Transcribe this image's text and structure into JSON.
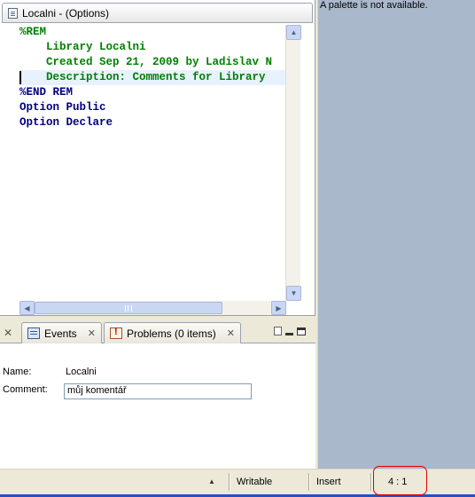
{
  "editor": {
    "tab_title": "Localni - (Options)",
    "lines": [
      "%REM",
      "    Library Localni",
      "    Created Sep 21, 2009 by Ladislav N",
      "    Description: Comments for Library",
      "%END REM",
      "Option Public",
      "Option Declare"
    ]
  },
  "palette": {
    "message": "A palette is not available."
  },
  "views": {
    "tabs": [
      "Events",
      "Problems (0 items)"
    ],
    "close_glyph": "✕"
  },
  "properties": {
    "name_label": "Name:",
    "name_value": "Localni",
    "comment_label": "Comment:",
    "comment_value": "můj komentář"
  },
  "status": {
    "access": "Writable",
    "mode": "Insert",
    "cursor": "4 : 1"
  },
  "colors": {
    "rem_text": "#008000",
    "keyword_text": "#000080",
    "highlight_box": "#e00000"
  }
}
